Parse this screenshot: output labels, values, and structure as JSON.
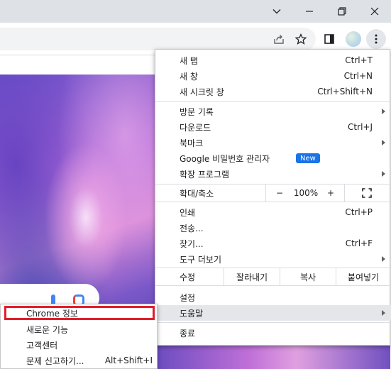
{
  "menu": {
    "new_tab": {
      "label": "새 탭",
      "shortcut": "Ctrl+T"
    },
    "new_window": {
      "label": "새 창",
      "shortcut": "Ctrl+N"
    },
    "new_incognito": {
      "label": "새 시크릿 창",
      "shortcut": "Ctrl+Shift+N"
    },
    "history": {
      "label": "방문 기록"
    },
    "downloads": {
      "label": "다운로드",
      "shortcut": "Ctrl+J"
    },
    "bookmarks": {
      "label": "북마크"
    },
    "password_manager": {
      "label": "Google 비밀번호 관리자",
      "badge": "New"
    },
    "extensions": {
      "label": "확장 프로그램"
    },
    "zoom": {
      "label": "확대/축소",
      "minus": "−",
      "value": "100%",
      "plus": "+"
    },
    "print": {
      "label": "인쇄",
      "shortcut": "Ctrl+P"
    },
    "cast": {
      "label": "전송..."
    },
    "find": {
      "label": "찾기...",
      "shortcut": "Ctrl+F"
    },
    "more_tools": {
      "label": "도구 더보기"
    },
    "edit": {
      "label": "수정",
      "cut": "잘라내기",
      "copy": "복사",
      "paste": "붙여넣기"
    },
    "settings": {
      "label": "설정"
    },
    "help": {
      "label": "도움말"
    },
    "exit": {
      "label": "종료"
    }
  },
  "help_submenu": {
    "about_chrome": {
      "label": "Chrome 정보"
    },
    "whats_new": {
      "label": "새로운 기능"
    },
    "help_center": {
      "label": "고객센터"
    },
    "report_issue": {
      "label": "문제 신고하기...",
      "shortcut": "Alt+Shift+I"
    }
  },
  "colors": {
    "highlight": "#e01e2b",
    "accent": "#1a73e8"
  }
}
